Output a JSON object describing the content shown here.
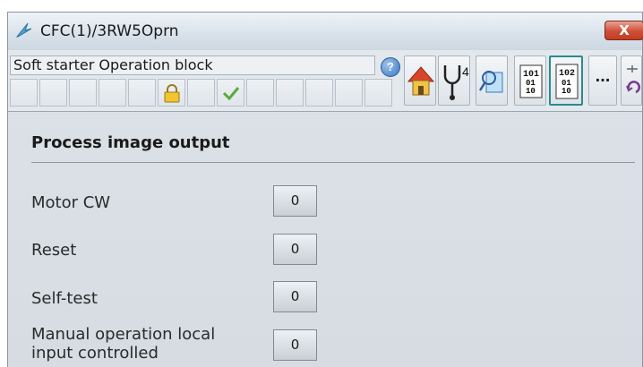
{
  "window": {
    "title": "CFC(1)/3RW5Oprn",
    "close_label": "X"
  },
  "toolbar": {
    "block_name": "Soft starter Operation block",
    "help_label": "?",
    "tab_b_label": "4",
    "tab_c_label": "...",
    "binary_1": [
      "101",
      "01",
      "10"
    ],
    "binary_2": [
      "102",
      "01",
      "10"
    ]
  },
  "main": {
    "section_title": "Process image output",
    "rows": [
      {
        "label": "Motor CW",
        "value": "0"
      },
      {
        "label": "Reset",
        "value": "0"
      },
      {
        "label": "Self-test",
        "value": "0"
      },
      {
        "label": "Manual operation local input controlled",
        "value": "0"
      }
    ]
  },
  "colors": {
    "panel_bg": "#d9dfe6",
    "close_button": "#cf4f36",
    "accent_blue": "#3a78c4"
  },
  "icons": [
    "app-icon",
    "help-icon",
    "home-icon",
    "stethoscope-icon",
    "magnifier-icon",
    "binary-101-icon",
    "binary-102-icon",
    "more-icon",
    "lock-icon",
    "checkmark-icon"
  ]
}
